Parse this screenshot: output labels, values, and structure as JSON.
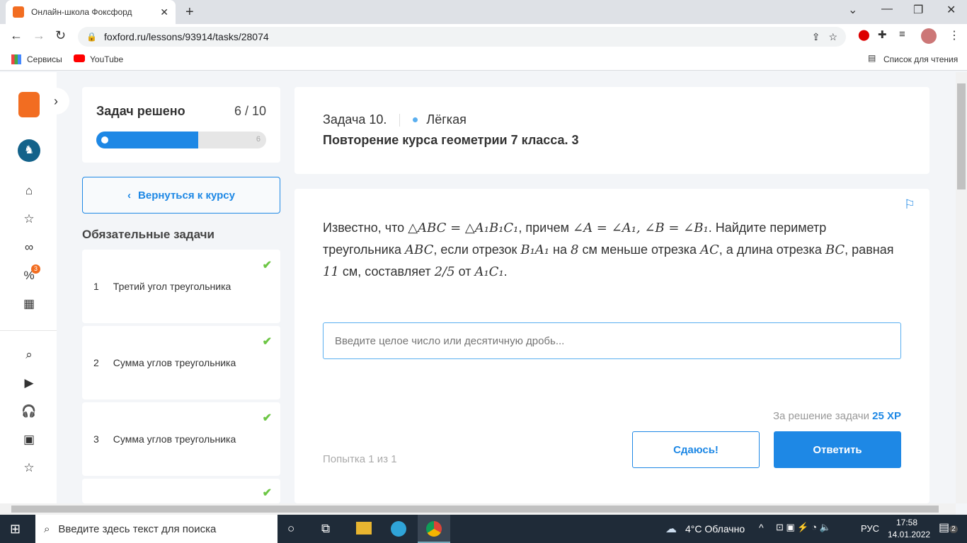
{
  "browser": {
    "tab_title": "Онлайн-школа Фоксфорд",
    "url": "foxford.ru/lessons/93914/tasks/28074",
    "bookmarks": [
      "Сервисы",
      "YouTube"
    ],
    "reading_list": "Список для чтения"
  },
  "progress": {
    "title": "Задач решено",
    "count": "6 / 10",
    "solved": 6,
    "total": 10,
    "end_label": "6"
  },
  "back_button": "Вернуться к курсу",
  "tasks_heading": "Обязательные задачи",
  "tasks": [
    {
      "num": "1",
      "title": "Третий угол треугольника"
    },
    {
      "num": "2",
      "title": "Сумма углов треугольника"
    },
    {
      "num": "3",
      "title": "Сумма углов треугольника"
    }
  ],
  "task": {
    "number": "Задача 10.",
    "difficulty": "Лёгкая",
    "title": "Повторение курса геометрии 7 класса. 3",
    "statement": [
      "Известно, что ",
      "△ABC = △A₁B₁C₁",
      ", причем ",
      "∠A = ∠A₁, ∠B = ∠B₁",
      ". Найдите периметр треугольника ",
      "ABC",
      ", если отрезок ",
      "B₁A₁",
      " на ",
      "8",
      " см меньше отрезка ",
      "AC",
      ", а длина отрезка ",
      "BC",
      ", равная ",
      "11",
      " см, составляет ",
      "2/5",
      " от ",
      "A₁C₁",
      "."
    ],
    "answer_placeholder": "Введите целое число или десятичную дробь...",
    "reward_label": "За решение задачи",
    "reward": "25 XP",
    "attempt": "Попытка 1 из 1",
    "give_up": "Сдаюсь!",
    "submit": "Ответить"
  },
  "taskbar": {
    "search": "Введите здесь текст для поиска",
    "weather": "4°C  Облачно",
    "lang": "РУС",
    "time": "17:58",
    "date": "14.01.2022",
    "notifications": "2"
  },
  "colors": {
    "accent": "#1e88e5",
    "check": "#6cc644"
  }
}
